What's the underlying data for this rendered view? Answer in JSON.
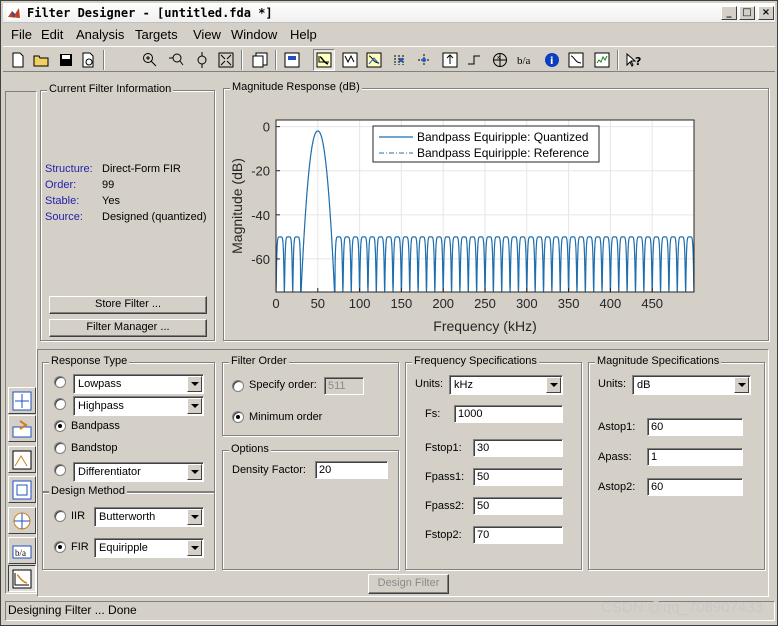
{
  "window": {
    "title": "Filter Designer -  [untitled.fda *]",
    "minimize": "_",
    "maximize": "□",
    "close": "×"
  },
  "menu": [
    {
      "label": "File",
      "accel": "F"
    },
    {
      "label": "Edit",
      "accel": "E"
    },
    {
      "label": "Analysis",
      "accel": "A"
    },
    {
      "label": "Targets",
      "accel": "a"
    },
    {
      "label": "View",
      "accel": "V"
    },
    {
      "label": "Window",
      "accel": "W"
    },
    {
      "label": "Help",
      "accel": "H"
    }
  ],
  "toolbar": [
    "new-icon",
    "open-icon",
    "save-icon",
    "print-preview-icon",
    "zoom-in-icon",
    "zoom-x-icon",
    "zoom-y-icon",
    "full-view-icon",
    "new-figure-icon",
    "filter-specs-icon",
    "magnitude-response-icon",
    "phase-response-icon",
    "magnitude-phase-icon",
    "group-delay-icon",
    "phase-delay-icon",
    "impulse-response-icon",
    "step-response-icon",
    "pole-zero-icon",
    "coefficients-icon",
    "info-icon",
    "magnitude-estimate-icon",
    "noise-power-icon",
    "whats-this-icon"
  ],
  "sidebar": [
    "transform-filter-icon",
    "import-filter-icon",
    "multirate-icon",
    "realize-model-icon",
    "pole-zero-editor-icon",
    "quantization-icon",
    "design-filter-icon"
  ],
  "current_filter": {
    "title": "Current Filter Information",
    "rows": [
      {
        "key": "Structure:",
        "value": "Direct-Form FIR"
      },
      {
        "key": "Order:",
        "value": "99"
      },
      {
        "key": "Stable:",
        "value": "Yes"
      },
      {
        "key": "Source:",
        "value": "Designed (quantized)"
      }
    ],
    "store_button": "Store Filter ...",
    "manager_button": "Filter Manager ..."
  },
  "magnitude_panel": {
    "title": "Magnitude Response (dB)"
  },
  "chart_data": {
    "type": "line",
    "title": "",
    "xlabel": "Frequency (kHz)",
    "ylabel": "Magnitude (dB)",
    "xlim": [
      0,
      500
    ],
    "ylim": [
      -75,
      3
    ],
    "xticks": [
      0,
      50,
      100,
      150,
      200,
      250,
      300,
      350,
      400,
      450
    ],
    "yticks": [
      0,
      -20,
      -40,
      -60
    ],
    "grid": true,
    "legend": "top-right",
    "series": [
      {
        "name": "Bandpass Equiripple: Quantized",
        "style": "solid",
        "color": "#1f6faf"
      },
      {
        "name": "Bandpass Equiripple: Reference",
        "style": "dashdot",
        "color": "#1f6faf"
      }
    ],
    "passband": [
      30,
      70
    ],
    "peak_db": -2,
    "stopband_ripple_db": -50,
    "lobe_spacing": 10
  },
  "response_type": {
    "title": "Response Type",
    "options": [
      {
        "label": "Lowpass",
        "type": "combo",
        "selected": false
      },
      {
        "label": "Highpass",
        "type": "combo",
        "selected": false
      },
      {
        "label": "Bandpass",
        "type": "plain",
        "selected": true
      },
      {
        "label": "Bandstop",
        "type": "plain",
        "selected": false
      },
      {
        "label": "Differentiator",
        "type": "combo",
        "selected": false
      }
    ]
  },
  "design_method": {
    "title": "Design Method",
    "iir_label": "IIR",
    "iir_value": "Butterworth",
    "fir_label": "FIR",
    "fir_value": "Equiripple",
    "selected": "FIR"
  },
  "filter_order": {
    "title": "Filter Order",
    "specify_label": "Specify order:",
    "specify_value": "511",
    "minimum_label": "Minimum order",
    "selected": "minimum"
  },
  "options": {
    "title": "Options",
    "density_label": "Density Factor:",
    "density_value": "20"
  },
  "freq_specs": {
    "title": "Frequency Specifications",
    "units_label": "Units:",
    "units_value": "kHz",
    "fields": [
      {
        "label": "Fs:",
        "value": "1000"
      },
      {
        "label": "Fstop1:",
        "value": "30"
      },
      {
        "label": "Fpass1:",
        "value": "50"
      },
      {
        "label": "Fpass2:",
        "value": "50"
      },
      {
        "label": "Fstop2:",
        "value": "70"
      }
    ]
  },
  "mag_specs": {
    "title": "Magnitude Specifications",
    "units_label": "Units:",
    "units_value": "dB",
    "fields": [
      {
        "label": "Astop1:",
        "value": "60"
      },
      {
        "label": "Apass:",
        "value": "1"
      },
      {
        "label": "Astop2:",
        "value": "60"
      }
    ]
  },
  "design_button": "Design Filter",
  "status": "Designing Filter ... Done",
  "watermark": "CSDN @qq_708907433"
}
